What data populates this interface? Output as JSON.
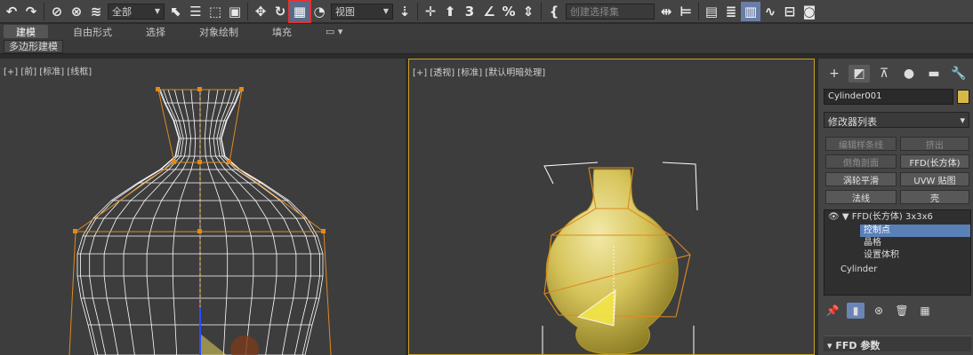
{
  "toolbar": {
    "selection_filter": "全部",
    "coord_system": "视图",
    "named_selection_placeholder": "创建选择集"
  },
  "ribbon": {
    "tabs": [
      "建模",
      "自由形式",
      "选择",
      "对象绘制",
      "填充"
    ],
    "active_tab": "建模",
    "sub_label": "多边形建模"
  },
  "viewports": {
    "left_label": "[+] [前] [标准] [线框]",
    "right_label": "[+] [透视] [标准] [默认明暗处理]"
  },
  "command_panel": {
    "object_name": "Cylinder001",
    "object_color": "#d6b849",
    "modifier_list": "修改器列表",
    "buttons": {
      "edit_spline": "编辑样条线",
      "extrude": "挤出",
      "chamfer": "倒角剖面",
      "ffd_box": "FFD(长方体)",
      "turbo_smooth": "涡轮平滑",
      "uvw_map": "UVW 贴图",
      "normal": "法线",
      "shell": "壳"
    },
    "stack": {
      "ffd": "FFD(长方体) 3x3x6",
      "control_points": "控制点",
      "lattice": "晶格",
      "set_volume": "设置体积",
      "cylinder": "Cylinder"
    },
    "rollout_title": "FFD 参数"
  },
  "colors": {
    "accent": "#c9a227",
    "highlight": "#5a80b8",
    "vase": "#d6c45a",
    "lattice": "#e08a1e"
  }
}
